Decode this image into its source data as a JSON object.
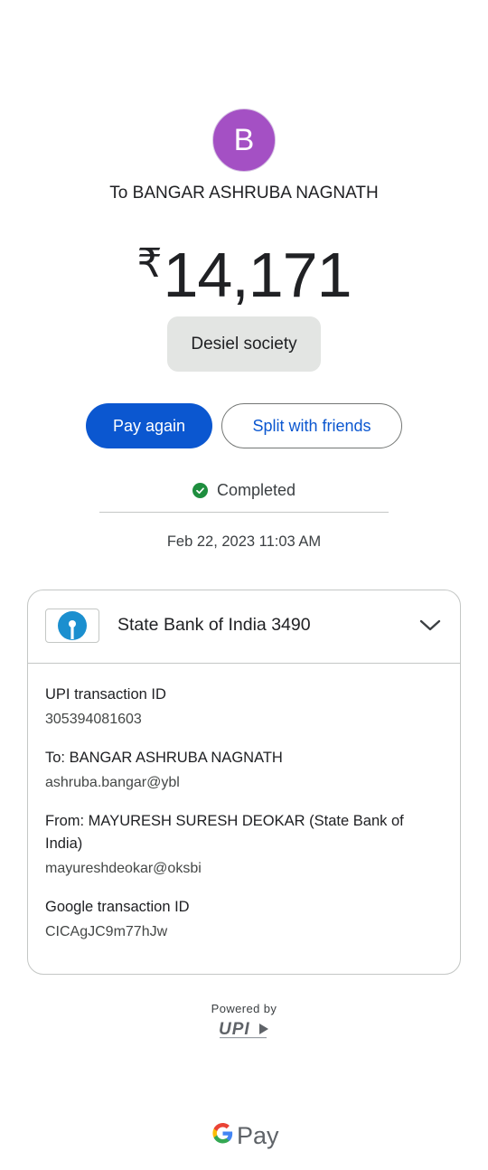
{
  "recipient": {
    "avatar_letter": "B",
    "avatar_color": "#a450c4",
    "title": "To BANGAR ASHRUBA NAGNATH"
  },
  "payment": {
    "currency_symbol": "₹",
    "amount": "14,171",
    "note": "Desiel society"
  },
  "actions": {
    "pay_again_label": "Pay again",
    "split_label": "Split with friends",
    "primary_color": "#0b57d0"
  },
  "status": {
    "label": "Completed",
    "icon": "check-circle-icon",
    "color": "#1e8e3e",
    "datetime": "Feb 22, 2023 11:03 AM"
  },
  "details": {
    "bank_icon": "sbi-logo-icon",
    "bank_name": "State Bank of India 3490",
    "expand_icon": "chevron-down-icon",
    "fields": [
      {
        "label": "UPI transaction ID",
        "value": "305394081603"
      },
      {
        "label": "To: BANGAR ASHRUBA NAGNATH",
        "value": "ashruba.bangar@ybl"
      },
      {
        "label": "From: MAYURESH SURESH DEOKAR (State Bank of India)",
        "value": "mayureshdeokar@oksbi"
      },
      {
        "label": "Google transaction ID",
        "value": "CICAgJC9m77hJw"
      }
    ]
  },
  "footer": {
    "powered_by": "Powered by",
    "upi_logo": "UPI",
    "brand_icon": "google-g-icon",
    "brand_text": "Pay"
  }
}
